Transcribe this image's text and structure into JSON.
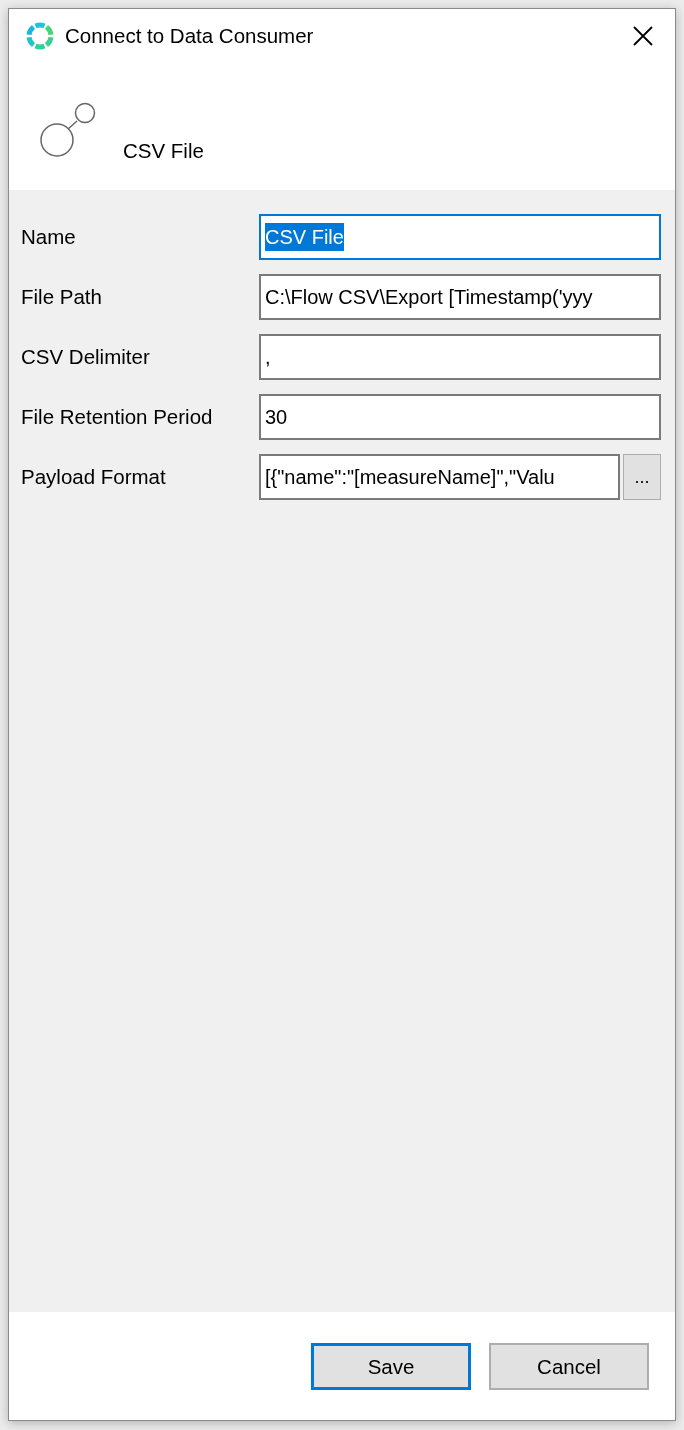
{
  "window": {
    "title": "Connect to Data Consumer"
  },
  "header": {
    "title": "CSV File"
  },
  "fields": [
    {
      "label": "Name",
      "value": "CSV File",
      "kind": "text",
      "focused": true,
      "value_selected": true
    },
    {
      "label": "File Path",
      "value": "C:\\Flow CSV\\Export [Timestamp('yyy",
      "kind": "text",
      "focused": false,
      "value_selected": false
    },
    {
      "label": "CSV Delimiter",
      "value": ",",
      "kind": "text",
      "focused": false,
      "value_selected": false
    },
    {
      "label": "File Retention Period",
      "value": "30",
      "kind": "text",
      "focused": false,
      "value_selected": false
    },
    {
      "label": "Payload Format",
      "value": "[{\"name\":\"[measureName]\",\"Valu",
      "kind": "browse",
      "button": "...",
      "focused": false,
      "value_selected": false
    }
  ],
  "buttons": [
    {
      "label": "Save",
      "default": true
    },
    {
      "label": "Cancel",
      "default": false
    }
  ]
}
